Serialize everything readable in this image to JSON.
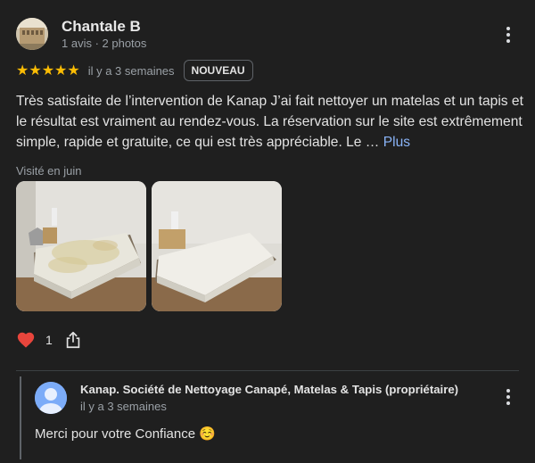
{
  "review": {
    "author_name": "Chantale B",
    "author_meta": "1 avis · 2 photos",
    "rating": 5,
    "stars": "★★★★★",
    "date": "il y a 3 semaines",
    "badge": "NOUVEAU",
    "text": "Très satisfaite de l’intervention de Kanap J’ai fait nettoyer un matelas et un tapis et le résultat est vraiment au rendez-vous. La réservation sur le site est extrêmement simple, rapide et gratuite, ce qui est très appréciable. Le …",
    "more_label": "Plus",
    "visited": "Visité en juin",
    "photos": [
      {
        "name": "photo-mattress-before",
        "icon": "photo"
      },
      {
        "name": "photo-mattress-after",
        "icon": "photo"
      }
    ],
    "reaction_count": "1",
    "reaction_icon": "heart-icon",
    "share_icon": "share-icon",
    "accent_color": "#8ab4f8",
    "star_color": "#fbbc04",
    "heart_color": "#e8453c"
  },
  "owner_reply": {
    "name": "Kanap. Société de Nettoyage Canapé, Matelas & Tapis (propriétaire)",
    "date": "il y a 3 semaines",
    "text": "Merci pour votre Confiance ☺️"
  }
}
